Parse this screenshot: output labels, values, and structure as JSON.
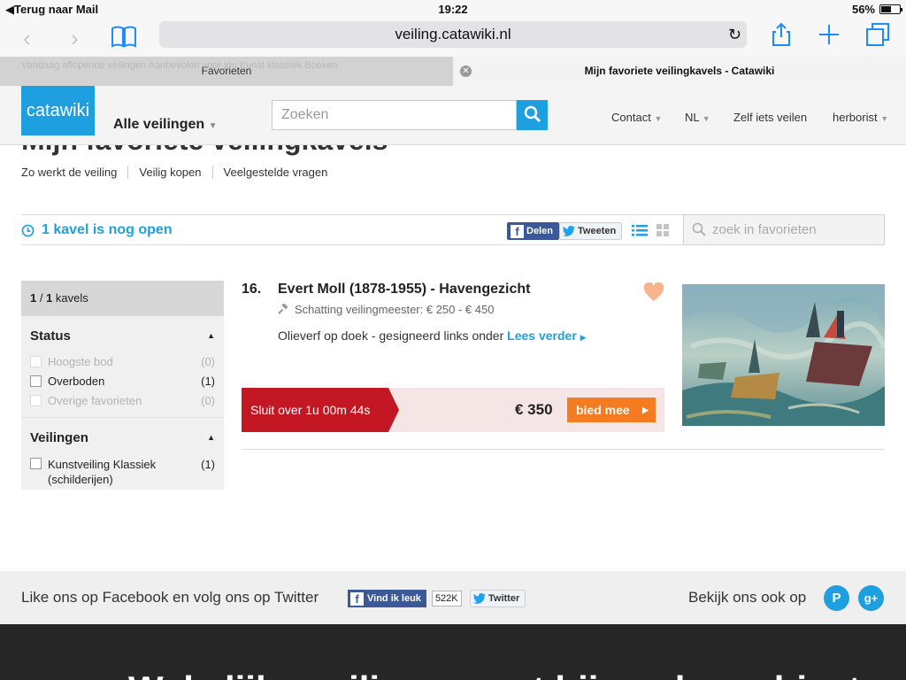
{
  "statusbar": {
    "back": "Terug naar Mail",
    "time": "19:22",
    "battery": "56%",
    "battery_level": 0.56
  },
  "browser": {
    "url": "veiling.catawiki.nl"
  },
  "tabs": [
    {
      "label": "Favorieten",
      "ghost": "Vandaag aflopende veilingen   Aanbevolen voor jou   Kunst klassiek   Boeken"
    },
    {
      "label": "Mijn favoriete veilingkavels - Catawiki"
    }
  ],
  "header": {
    "logo": "catawiki",
    "all_auctions": "Alle veilingen",
    "search_placeholder": "Zoeken",
    "nav": [
      "Contact",
      "NL",
      "Zelf iets veilen",
      "herborist"
    ]
  },
  "page": {
    "title": "Mijn favoriete veilingkavels",
    "subnav": [
      "Zo werkt de veiling",
      "Veilig kopen",
      "Veelgestelde vragen"
    ],
    "open_count": "1 kavel is nog open",
    "share_fb": "Delen",
    "share_tw": "Tweeten",
    "fav_search_placeholder": "zoek in favorieten"
  },
  "sidebar": {
    "count_a": "1",
    "count_sep": " / ",
    "count_b": "1",
    "count_label": " kavels",
    "status_title": "Status",
    "status_items": [
      {
        "label": "Hoogste bod",
        "count": "(0)"
      },
      {
        "label": "Overboden",
        "count": "(1)"
      },
      {
        "label": "Overige favorieten",
        "count": "(0)"
      }
    ],
    "auctions_title": "Veilingen",
    "auction_items": [
      {
        "label": "Kunstveiling Klassiek (schilderijen)",
        "count": "(1)"
      }
    ]
  },
  "lot": {
    "number": "16.",
    "title": "Evert Moll (1878-1955) - Havengezicht",
    "estimate": "Schatting veilingmeester: € 250 - € 450",
    "description": "Olieverf op doek - gesigneerd links onder",
    "read_more": "Lees verder",
    "closing": "Sluit over 1u 00m 44s",
    "price": "€ 350",
    "bid_button": "bied mee"
  },
  "social": {
    "text": "Like ons op Facebook en volg ons op Twitter",
    "fb_like": "Vind ik leuk",
    "fb_count": "522K",
    "twitter": "Twitter",
    "also_text": "Bekijk ons ook op"
  },
  "footer": {
    "headline": "Wekelijks veilingen met bijzondere objecten"
  },
  "colors": {
    "brand": "#1e9fe0",
    "closing": "#c31823",
    "bid": "#f47b20",
    "heart": "#f8b48a"
  }
}
